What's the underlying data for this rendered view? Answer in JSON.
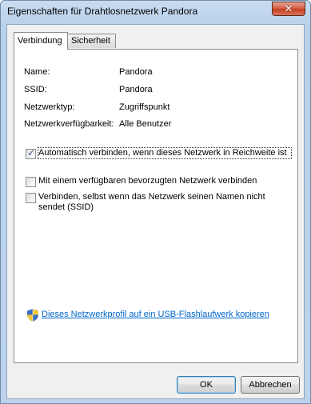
{
  "window": {
    "title": "Eigenschaften für Drahtlosnetzwerk Pandora",
    "close_icon": "close-icon"
  },
  "tabs": [
    {
      "label": "Verbindung",
      "active": true
    },
    {
      "label": "Sicherheit",
      "active": false
    }
  ],
  "info": [
    {
      "label": "Name:",
      "value": "Pandora"
    },
    {
      "label": "SSID:",
      "value": "Pandora"
    },
    {
      "label": "Netzwerktyp:",
      "value": "Zugriffspunkt"
    },
    {
      "label": "Netzwerkverfügbarkeit:",
      "value": "Alle Benutzer"
    }
  ],
  "options": [
    {
      "label": "Automatisch verbinden, wenn dieses Netzwerk in Reichweite ist",
      "checked": true
    },
    {
      "label": "Mit einem verfügbaren bevorzugten Netzwerk verbinden",
      "checked": false
    },
    {
      "label": "Verbinden, selbst wenn das Netzwerk seinen Namen nicht sendet (SSID)",
      "checked": false
    }
  ],
  "link": {
    "icon": "uac-shield-icon",
    "text": "Dieses Netzwerkprofil auf ein USB-Flashlaufwerk kopieren",
    "color": "#0066cc"
  },
  "buttons": {
    "ok_label": "OK",
    "cancel_label": "Abbrechen"
  }
}
